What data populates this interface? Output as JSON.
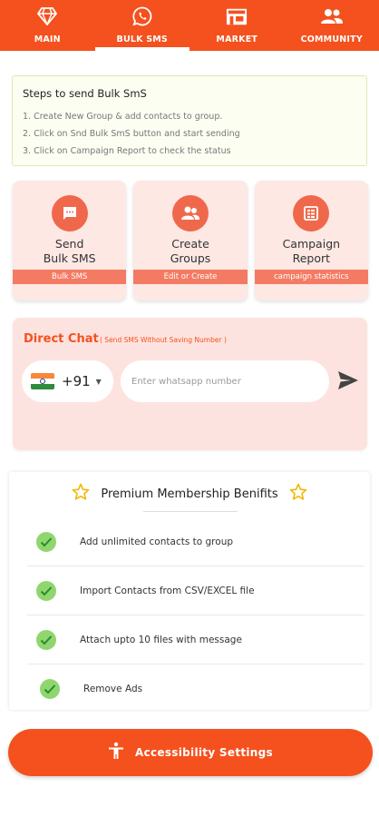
{
  "nav": {
    "items": [
      {
        "label": "MAIN",
        "icon": "diamond-icon"
      },
      {
        "label": "BULK SMS",
        "icon": "whatsapp-icon"
      },
      {
        "label": "MARKET",
        "icon": "store-icon"
      },
      {
        "label": "COMMUNITY",
        "icon": "group-icon"
      }
    ],
    "active": "BULK SMS"
  },
  "steps": {
    "title": "Steps to send Bulk SmS",
    "lines": [
      "1. Create New Group & add contacts to group.",
      "2. Click on Snd Bulk SmS button and start sending",
      "3. Click on Campaign Report to check the status"
    ]
  },
  "cards": [
    {
      "title": "Send\nBulk SMS",
      "subtitle": "Bulk SMS",
      "icon": "message-icon"
    },
    {
      "title": "Create\nGroups",
      "subtitle": "Edit or Create",
      "icon": "contacts-icon"
    },
    {
      "title": "Campaign\nReport",
      "subtitle": "campaign statistics",
      "icon": "report-icon"
    }
  ],
  "direct_chat": {
    "title": "Direct Chat",
    "subtitle": "( Send SMS Without Saving Number )",
    "country_code": "+91",
    "country_flag": "india-flag",
    "phone_placeholder": "Enter whatsapp number",
    "send_icon": "send-icon"
  },
  "premium": {
    "title": "Premium Membership Benifits",
    "benefits": [
      "Add unlimited contacts to group",
      "Import Contacts from CSV/EXCEL file",
      "Attach upto 10 files with message",
      "Remove Ads"
    ]
  },
  "accessibility": {
    "label": "Accessibility Settings",
    "icon": "accessibility-icon"
  },
  "colors": {
    "primary": "#f4511e",
    "card_bg": "#fde8e4",
    "icon_circle": "#f0684b",
    "card_bar": "#f47b63",
    "check": "#8fd66f",
    "star": "#f2b705"
  }
}
